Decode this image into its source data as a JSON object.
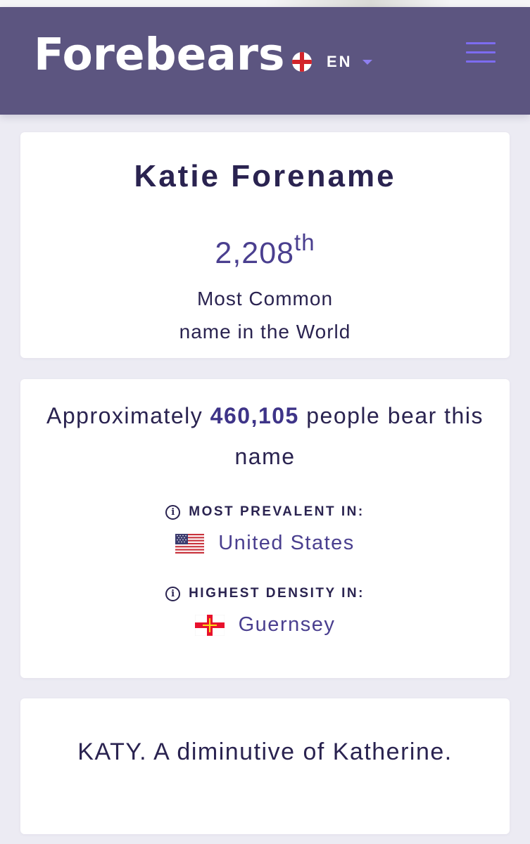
{
  "header": {
    "logo": "Forebears",
    "language_code": "EN",
    "language_flag_icon": "england-flag-icon",
    "menu_icon": "hamburger-menu-icon",
    "brand_color": "#5c5580",
    "accent_color": "#7d6cf0"
  },
  "name_card": {
    "title": "Katie Forename",
    "rank_number": "2,208",
    "rank_suffix": "th",
    "rank_line1": "Most Common",
    "rank_line2": "name in the World"
  },
  "stats_card": {
    "approx_prefix": "Approximately",
    "approx_count": "460,105",
    "approx_suffix": "people bear this name",
    "most_prevalent_label": "MOST PREVALENT IN:",
    "most_prevalent_country": "United States",
    "most_prevalent_flag_icon": "usa-flag-icon",
    "highest_density_label": "HIGHEST DENSITY IN:",
    "highest_density_country": "Guernsey",
    "highest_density_flag_icon": "guernsey-flag-icon",
    "info_icon": "info-icon"
  },
  "meaning_card": {
    "text": "KATY. A diminutive of Katherine."
  }
}
